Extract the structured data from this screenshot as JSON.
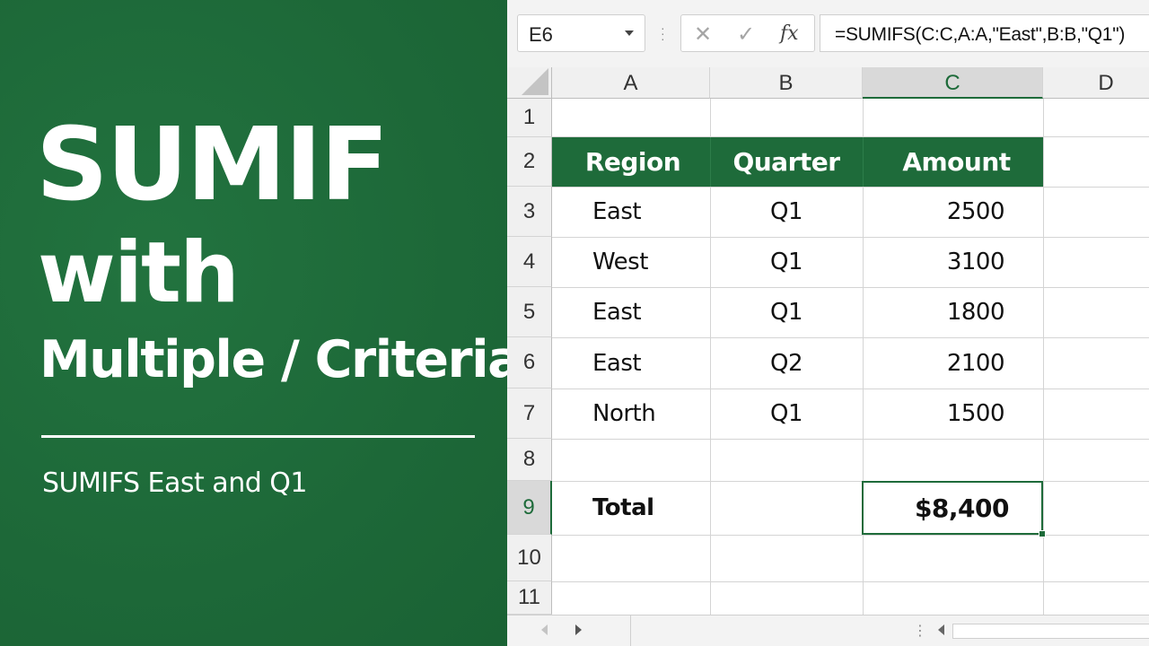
{
  "title": {
    "line1": "SUMIF",
    "line2": "with",
    "line3": "Multiple / Criteria",
    "subtitle": "SUMIFS East and Q1"
  },
  "formula_bar": {
    "name_box": "E6",
    "cancel_icon": "✕",
    "enter_icon": "✓",
    "function_icon": "fx",
    "formula": "=SUMIFS(C:C,A:A,\"East\",B:B,\"Q1\")"
  },
  "columns": [
    "A",
    "B",
    "C",
    "D"
  ],
  "rows": [
    "1",
    "2",
    "3",
    "4",
    "5",
    "6",
    "7",
    "8",
    "9",
    "10",
    "11"
  ],
  "table": {
    "headers": [
      "Region",
      "Quarter",
      "Amount"
    ],
    "data": [
      {
        "region": "East",
        "quarter": "Q1",
        "amount": "2500"
      },
      {
        "region": "West",
        "quarter": "Q1",
        "amount": "3100"
      },
      {
        "region": "East",
        "quarter": "Q1",
        "amount": "1800"
      },
      {
        "region": "East",
        "quarter": "Q2",
        "amount": "2100"
      },
      {
        "region": "North",
        "quarter": "Q1",
        "amount": "1500"
      }
    ],
    "total_label": "Total",
    "total_value": "$8,400"
  },
  "colors": {
    "brand_green": "#1e6b3a",
    "header_bg": "#1e6b3a",
    "grid_line": "#d4d4d4"
  }
}
